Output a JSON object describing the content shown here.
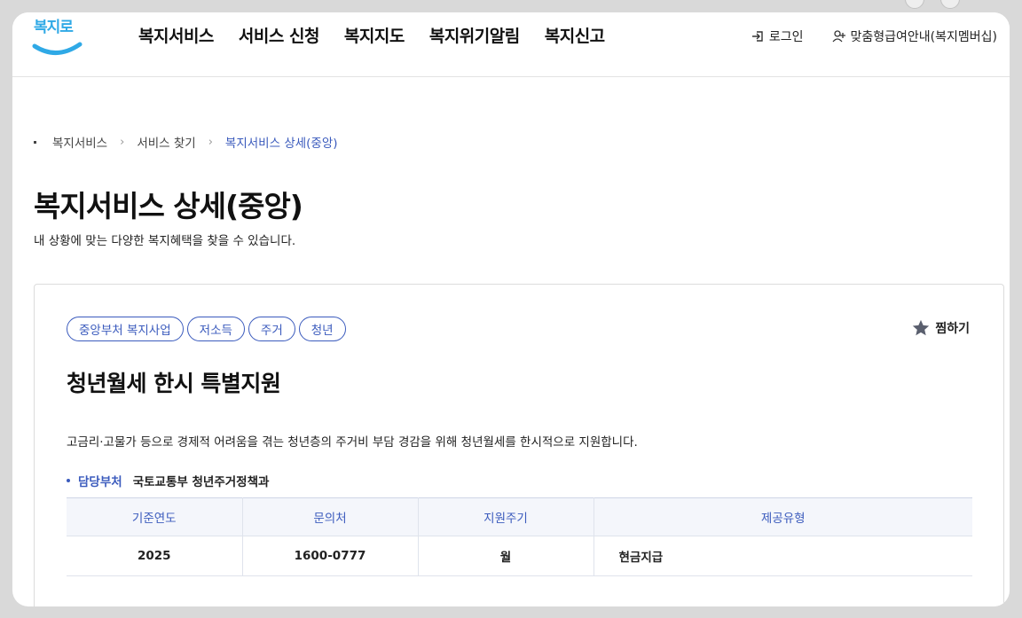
{
  "header": {
    "logo_text": "복지로",
    "nav": [
      "복지서비스",
      "서비스 신청",
      "복지지도",
      "복지위기알림",
      "복지신고"
    ],
    "login_label": "로그인",
    "membership_label": "맞춤형급여안내(복지멤버십)"
  },
  "breadcrumb": {
    "items": [
      "복지서비스",
      "서비스 찾기"
    ],
    "current": "복지서비스 상세(중앙)"
  },
  "page": {
    "title": "복지서비스 상세(중앙)",
    "description": "내 상황에 맞는 다양한 복지혜택을 찾을 수 있습니다."
  },
  "service": {
    "tags": [
      "중앙부처 복지사업",
      "저소득",
      "주거",
      "청년"
    ],
    "favorite_label": "찜하기",
    "title": "청년월세 한시 특별지원",
    "description": "고금리·고물가 등으로 경제적 어려움을 겪는 청년층의 주거비 부담 경감을 위해 청년월세를 한시적으로 지원합니다.",
    "dept_label": "담당부처",
    "dept_value": "국토교통부 청년주거정책과",
    "table": {
      "headers": [
        "기준연도",
        "문의처",
        "지원주기",
        "제공유형"
      ],
      "row": [
        "2025",
        "1600-0777",
        "월",
        "현금지급"
      ]
    }
  },
  "colors": {
    "accent": "#3b5bbd",
    "logo": "#2fa9e6",
    "table_header_bg": "#f4f6fb"
  }
}
